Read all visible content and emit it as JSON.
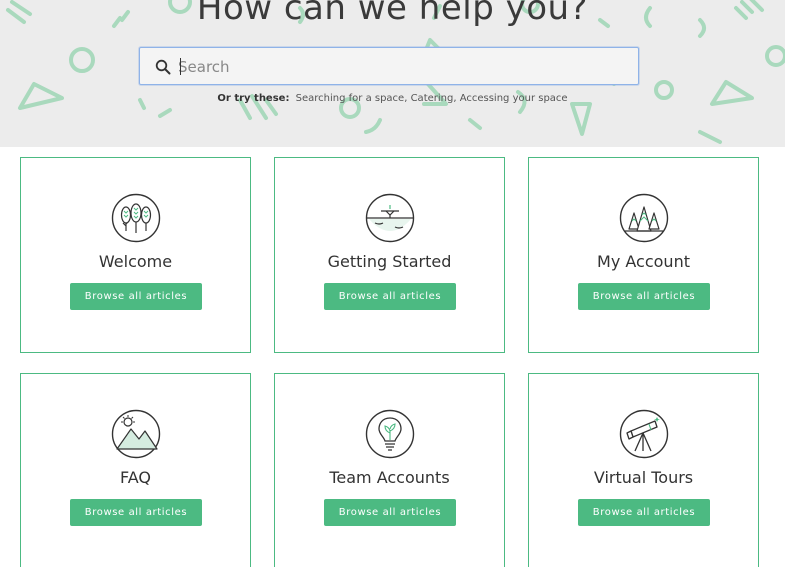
{
  "hero": {
    "title": "How can we help you?",
    "search_placeholder": "Search",
    "try_label": "Or try these:",
    "suggestions": [
      "Searching for a space,",
      "Catering,",
      "Accessing your space"
    ]
  },
  "colors": {
    "accent": "#4cba82",
    "hero_bg": "#ececec",
    "pattern": "#a9d9bd"
  },
  "categories": [
    {
      "title": "Welcome",
      "button": "Browse all articles",
      "icon": "trees-icon"
    },
    {
      "title": "Getting Started",
      "button": "Browse all articles",
      "icon": "landing-icon"
    },
    {
      "title": "My Account",
      "button": "Browse all articles",
      "icon": "forest-icon"
    },
    {
      "title": "FAQ",
      "button": "Browse all articles",
      "icon": "mountain-icon"
    },
    {
      "title": "Team Accounts",
      "button": "Browse all articles",
      "icon": "lightbulb-icon"
    },
    {
      "title": "Virtual Tours",
      "button": "Browse all articles",
      "icon": "telescope-icon"
    }
  ]
}
